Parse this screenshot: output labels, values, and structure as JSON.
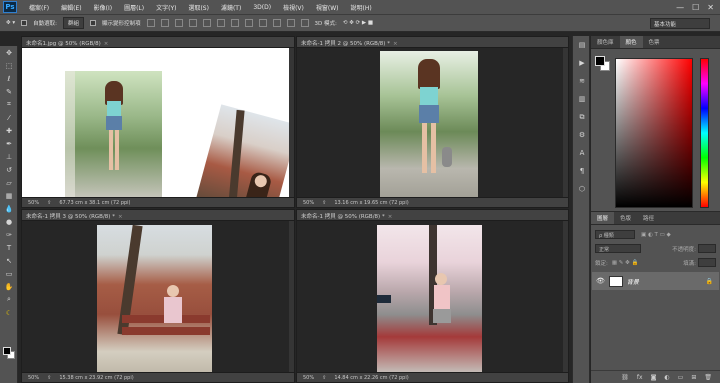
{
  "app": {
    "logo": "Ps"
  },
  "menu": [
    "檔案(F)",
    "編輯(E)",
    "影像(I)",
    "圖層(L)",
    "文字(Y)",
    "選取(S)",
    "濾鏡(T)",
    "3D(D)",
    "檢視(V)",
    "視窗(W)",
    "說明(H)"
  ],
  "window_controls": {
    "min": "—",
    "max": "☐",
    "close": "✕"
  },
  "options": {
    "auto_select_label": "自動選取:",
    "auto_select_value": "群組",
    "transform_label": "顯示變形控制項",
    "mode_3d_label": "3D 模式:",
    "workspace": "基本功能"
  },
  "docs": [
    {
      "tab": "未命名1.jpg @ 50% (RGB/8)",
      "close": "×",
      "zoom": "50%",
      "info": "67.73 cm x 38.1 cm (72 ppi)"
    },
    {
      "tab": "未命名-1 拷貝 2 @ 50% (RGB/8) *",
      "close": "×",
      "zoom": "50%",
      "info": "13.16 cm x 19.65 cm (72 ppi)"
    },
    {
      "tab": "未命名-1 拷貝 3 @ 50% (RGB/8) *",
      "close": "×",
      "zoom": "50%",
      "info": "15.38 cm x 23.92 cm (72 ppi)"
    },
    {
      "tab": "未命名-1 拷貝 @ 50% (RGB/8) *",
      "close": "×",
      "zoom": "50%",
      "info": "14.84 cm x 22.26 cm (72 ppi)"
    }
  ],
  "color_panel": {
    "tabs": [
      "顏色庫",
      "顏色",
      "色票"
    ],
    "active_tab": 1,
    "fg_color": "#000000",
    "bg_color": "#ffffff"
  },
  "layers_panel": {
    "tabs": [
      "圖層",
      "色版",
      "路徑"
    ],
    "filter_label": "ρ 種類",
    "blend_mode": "正常",
    "opacity_label": "不透明度:",
    "lock_label": "鎖定:",
    "fill_label": "填滿:",
    "layer_name": "背景",
    "lock_icon": "🔒"
  }
}
